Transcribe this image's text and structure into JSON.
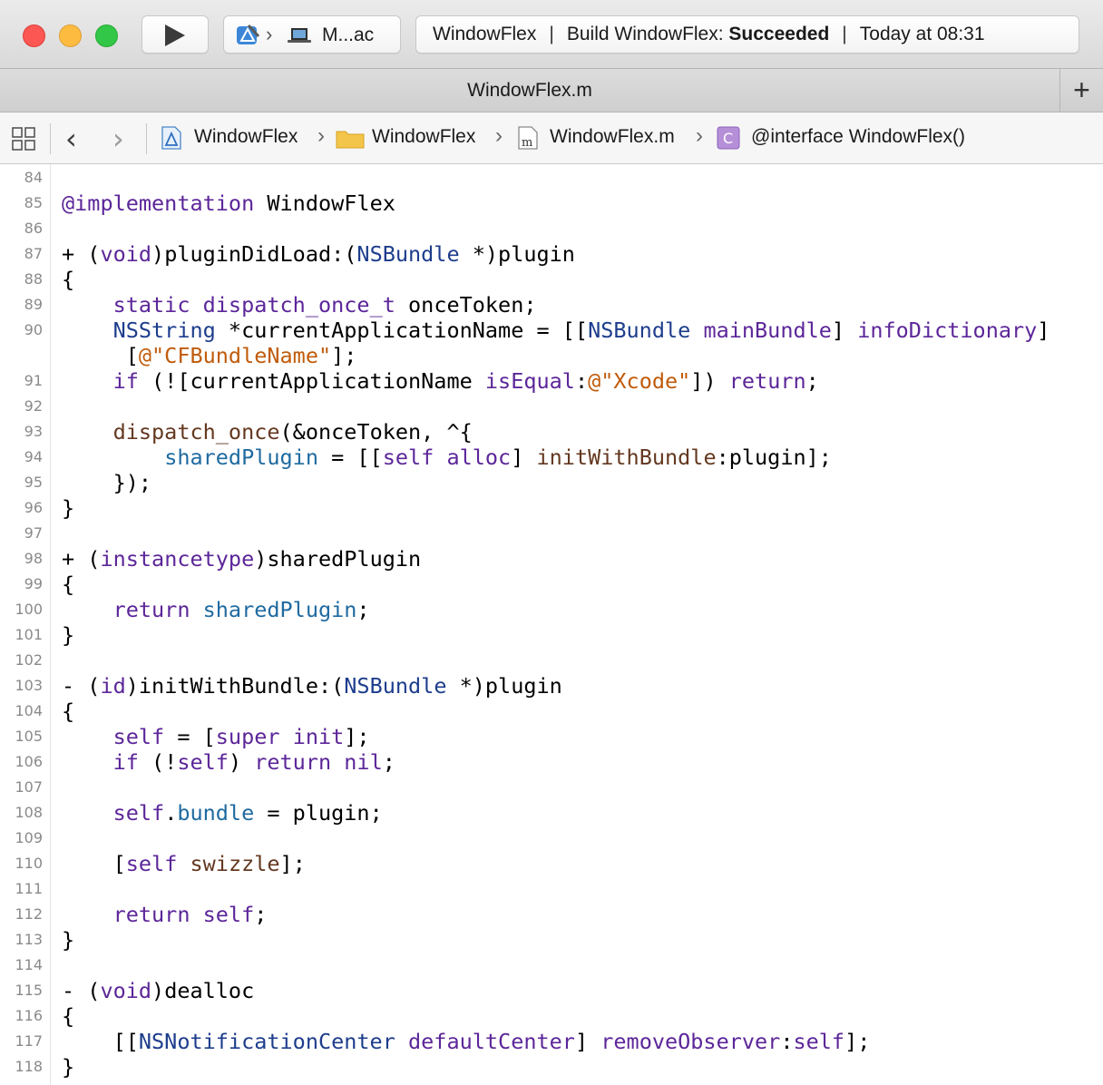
{
  "window": {
    "run_button_icon": "play-icon",
    "scheme_app_icon": "xcode-app-icon",
    "scheme_destination": "M...ac",
    "activity": {
      "project": "WindowFlex",
      "action_prefix": "Build WindowFlex: ",
      "status": "Succeeded",
      "time": "Today at 08:31"
    }
  },
  "tab": {
    "title": "WindowFlex.m",
    "add_label": "+"
  },
  "jumpbar": {
    "crumbs": [
      {
        "label": "WindowFlex",
        "icon": "project-icon"
      },
      {
        "label": "WindowFlex",
        "icon": "folder-icon"
      },
      {
        "label": "WindowFlex.m",
        "icon": "m-file-icon"
      },
      {
        "label": "@interface WindowFlex()",
        "icon": "class-icon"
      }
    ]
  },
  "editor": {
    "line_numbers": [
      "84",
      "85",
      "86",
      "87",
      "88",
      "89",
      "90",
      "",
      "91",
      "92",
      "93",
      "94",
      "95",
      "96",
      "97",
      "98",
      "99",
      "100",
      "101",
      "102",
      "103",
      "104",
      "105",
      "106",
      "107",
      "108",
      "109",
      "110",
      "111",
      "112",
      "113",
      "114",
      "115",
      "116",
      "117",
      "118"
    ]
  },
  "colors": {
    "keyword": "#aa0d91",
    "type": "#5c2699",
    "string": "#c05b0b",
    "variable": "#1f6aa0",
    "success": "#1a1a1a"
  }
}
